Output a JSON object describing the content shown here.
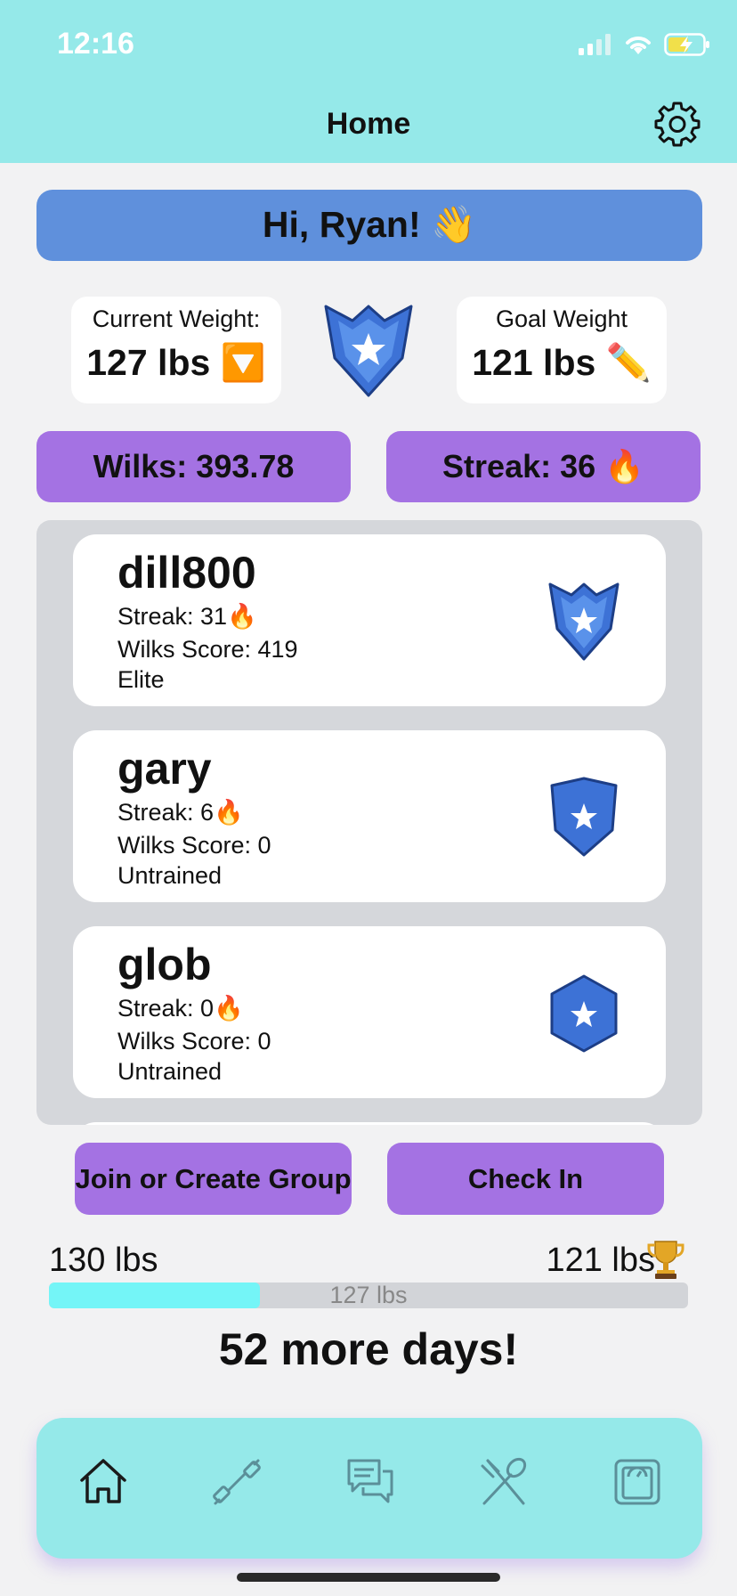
{
  "status_bar": {
    "time": "12:16"
  },
  "header": {
    "title": "Home"
  },
  "greeting": {
    "text": "Hi, Ryan! 👋"
  },
  "current_weight": {
    "label": "Current Weight:",
    "value": "127 lbs 🔽"
  },
  "goal_weight": {
    "label": "Goal Weight",
    "value": "121 lbs ✏️"
  },
  "stats": {
    "wilks": "Wilks: 393.78",
    "streak": "Streak: 36 🔥"
  },
  "leaderboard": [
    {
      "username": "dill800",
      "streak": "Streak: 31🔥",
      "wilks": "Wilks Score: 419",
      "rank": "Elite",
      "badge_icon": "elite-shield-icon"
    },
    {
      "username": "gary",
      "streak": "Streak: 6🔥",
      "wilks": "Wilks Score: 0",
      "rank": "Untrained",
      "badge_icon": "shield-icon"
    },
    {
      "username": "glob",
      "streak": "Streak: 0🔥",
      "wilks": "Wilks Score: 0",
      "rank": "Untrained",
      "badge_icon": "hexagon-star-icon"
    }
  ],
  "actions": {
    "join_group": "Join or Create Group",
    "check_in": "Check In"
  },
  "progress": {
    "start_label": "130 lbs",
    "goal_label": "121 lbs",
    "current_label": "127 lbs",
    "fraction_complete": 0.33,
    "days_left": "52 more days!"
  },
  "tabs": [
    {
      "name": "home-icon",
      "active": true
    },
    {
      "name": "dumbbell-icon",
      "active": false
    },
    {
      "name": "chat-icon",
      "active": false
    },
    {
      "name": "fork-spoon-icon",
      "active": false
    },
    {
      "name": "scale-icon",
      "active": false
    }
  ],
  "colors": {
    "header_bg": "#95e9e9",
    "greeting_bg": "#5f90dc",
    "accent_purple": "#a472e3",
    "progress_fill": "#74f5f7",
    "badge_blue": "#3f78dc"
  }
}
